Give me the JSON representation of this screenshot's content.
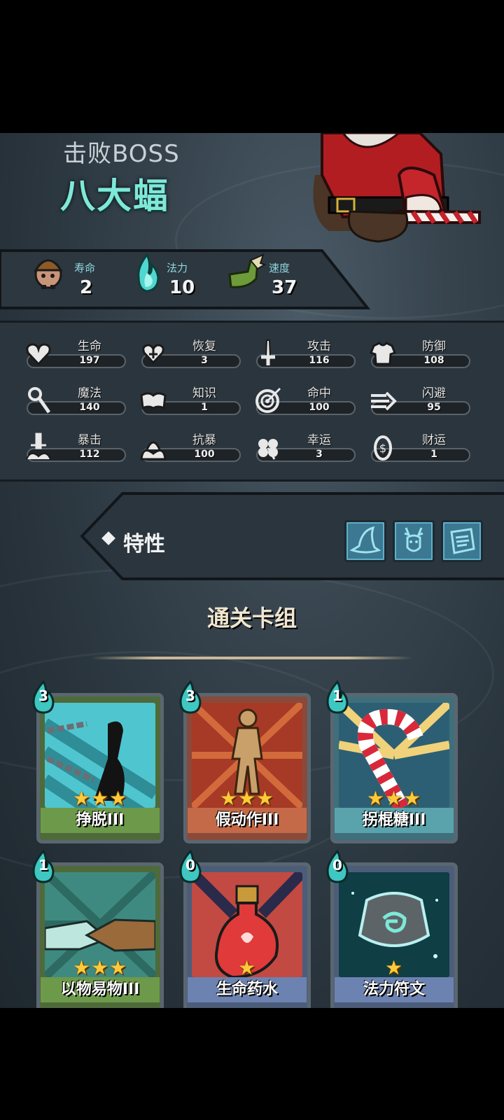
{
  "header": {
    "subtitle": "击败BOSS",
    "boss_name": "八大蝠"
  },
  "resources": [
    {
      "label": "寿命",
      "value": "2",
      "icon": "player-doll-icon"
    },
    {
      "label": "法力",
      "value": "10",
      "icon": "mana-flame-icon"
    },
    {
      "label": "速度",
      "value": "37",
      "icon": "winged-boot-icon"
    }
  ],
  "stats": [
    {
      "label": "生命",
      "value": "197",
      "icon": "heart-icon"
    },
    {
      "label": "恢复",
      "value": "3",
      "icon": "heal-heart-icon"
    },
    {
      "label": "攻击",
      "value": "116",
      "icon": "sword-icon"
    },
    {
      "label": "防御",
      "value": "108",
      "icon": "armor-icon"
    },
    {
      "label": "魔法",
      "value": "140",
      "icon": "staff-icon"
    },
    {
      "label": "知识",
      "value": "1",
      "icon": "book-icon"
    },
    {
      "label": "命中",
      "value": "100",
      "icon": "target-icon"
    },
    {
      "label": "闪避",
      "value": "95",
      "icon": "dash-arrow-icon"
    },
    {
      "label": "暴击",
      "value": "112",
      "icon": "crit-sword-icon"
    },
    {
      "label": "抗暴",
      "value": "100",
      "icon": "shield-burst-icon"
    },
    {
      "label": "幸运",
      "value": "3",
      "icon": "clover-icon"
    },
    {
      "label": "财运",
      "value": "1",
      "icon": "coin-icon"
    }
  ],
  "traits": {
    "label": "特性",
    "items": [
      {
        "icon": "witch-hat-icon"
      },
      {
        "icon": "reindeer-icon"
      },
      {
        "icon": "scroll-icon"
      }
    ]
  },
  "deck": {
    "title": "通关卡组",
    "cards": [
      {
        "name": "挣脱III",
        "cost": "3",
        "stars": "★★★",
        "frame": "#4f6a3a",
        "bar": "#6d9a4a",
        "art": "chain-escape",
        "rarity": 3
      },
      {
        "name": "假动作III",
        "cost": "3",
        "stars": "★★★",
        "frame": "#8a4a3a",
        "bar": "#c56a48",
        "art": "mannequin",
        "rarity": 3
      },
      {
        "name": "拐棍糖III",
        "cost": "1",
        "stars": "★★★",
        "frame": "#3f6f7a",
        "bar": "#5aa3ad",
        "art": "candy-cane",
        "rarity": 3
      },
      {
        "name": "以物易物III",
        "cost": "1",
        "stars": "★★★",
        "frame": "#4f6a3a",
        "bar": "#6d9a4a",
        "art": "handshake",
        "rarity": 3
      },
      {
        "name": "生命药水",
        "cost": "0",
        "stars": "★",
        "frame": "#4c5d7a",
        "bar": "#6c82b0",
        "art": "potion",
        "rarity": 1
      },
      {
        "name": "法力符文",
        "cost": "0",
        "stars": "★",
        "frame": "#4c5d7a",
        "bar": "#6c82b0",
        "art": "rune",
        "rarity": 1
      }
    ]
  }
}
